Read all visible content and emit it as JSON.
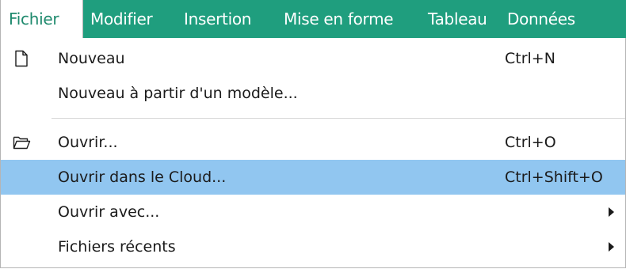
{
  "menubar": {
    "items": [
      {
        "label": "Fichier"
      },
      {
        "label": "Modifier"
      },
      {
        "label": "Insertion"
      },
      {
        "label": "Mise en forme"
      },
      {
        "label": "Tableau"
      },
      {
        "label": "Données"
      }
    ],
    "active": "Fichier"
  },
  "menu": {
    "items": [
      {
        "label": "Nouveau",
        "shortcut": "Ctrl+N",
        "icon": "new-document-icon"
      },
      {
        "label": "Nouveau à partir d'un modèle...",
        "shortcut": ""
      },
      {
        "label": "Ouvrir...",
        "shortcut": "Ctrl+O",
        "icon": "open-folder-icon"
      },
      {
        "label": "Ouvrir dans le Cloud...",
        "shortcut": "Ctrl+Shift+O",
        "highlighted": true
      },
      {
        "label": "Ouvrir avec...",
        "submenu": true
      },
      {
        "label": "Fichiers récents",
        "submenu": true
      }
    ]
  },
  "colors": {
    "menubar_background": "#1f9e7e",
    "menubar_text": "#ffffff",
    "active_tab_text": "#1f8a6e",
    "highlight": "#91c6f0"
  }
}
